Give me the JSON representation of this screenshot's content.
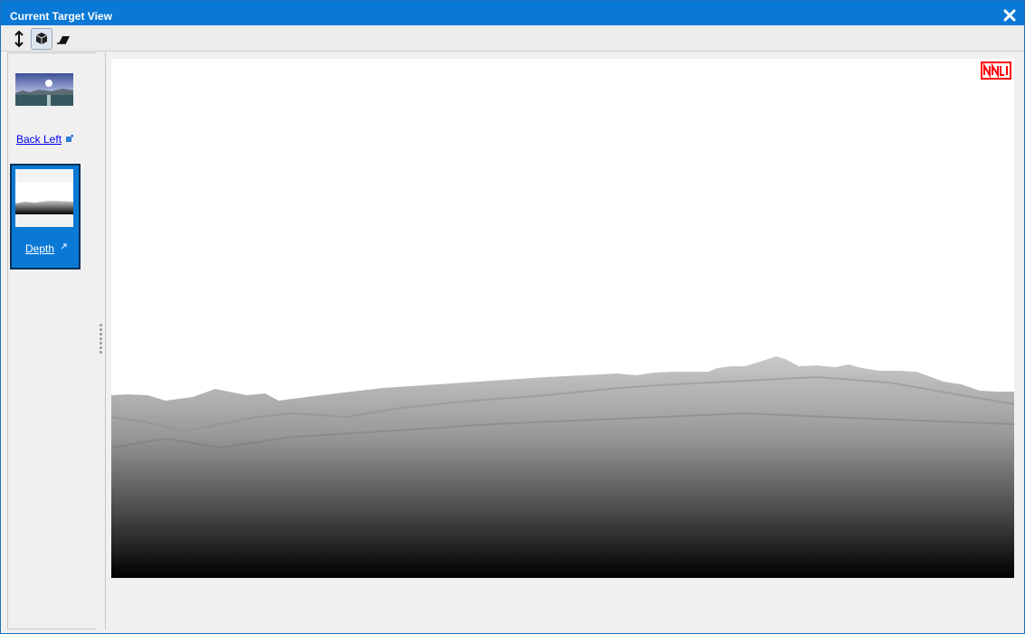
{
  "window": {
    "title": "Current Target View"
  },
  "toolbar": {
    "tools": [
      {
        "icon": "vertical-arrows-icon"
      },
      {
        "icon": "cube-icon",
        "active": true
      },
      {
        "icon": "eraser-icon"
      }
    ]
  },
  "targets": [
    {
      "label": "Back Left",
      "icon": "external-link-icon",
      "selected": false
    },
    {
      "label": "Depth",
      "icon": "external-link-icon",
      "selected": true
    }
  ],
  "colors": {
    "titlebar": "#0a79d6",
    "selection": "#0a79d6",
    "badge": "#ff0000"
  }
}
